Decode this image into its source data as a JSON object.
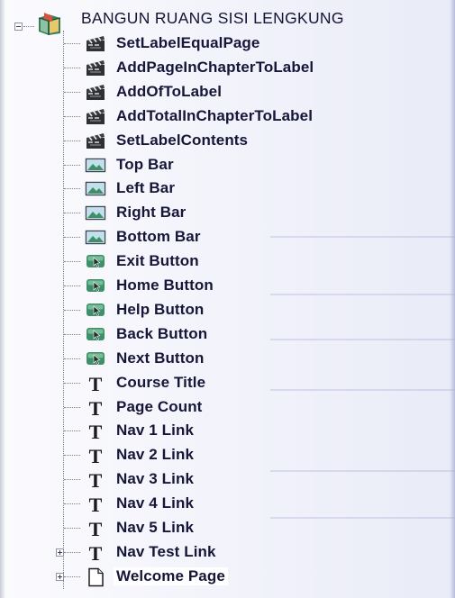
{
  "tree": {
    "root": {
      "label": "BANGUN RUANG SISI LENGKUNG",
      "icon": "book-icon",
      "expanded": true
    },
    "items": [
      {
        "label": "SetLabelEqualPage",
        "icon": "action-clapper-icon"
      },
      {
        "label": "AddPageInChapterToLabel",
        "icon": "action-clapper-icon"
      },
      {
        "label": "AddOfToLabel",
        "icon": "action-clapper-icon"
      },
      {
        "label": "AddTotalInChapterToLabel",
        "icon": "action-clapper-icon"
      },
      {
        "label": "SetLabelContents",
        "icon": "action-clapper-icon"
      },
      {
        "label": "Top Bar",
        "icon": "image-icon"
      },
      {
        "label": "Left Bar",
        "icon": "image-icon"
      },
      {
        "label": "Right Bar",
        "icon": "image-icon"
      },
      {
        "label": "Bottom Bar",
        "icon": "image-icon"
      },
      {
        "label": "Exit Button",
        "icon": "button-icon"
      },
      {
        "label": "Home Button",
        "icon": "button-icon"
      },
      {
        "label": "Help Button",
        "icon": "button-icon"
      },
      {
        "label": "Back Button",
        "icon": "button-icon"
      },
      {
        "label": "Next Button",
        "icon": "button-icon"
      },
      {
        "label": "Course Title",
        "icon": "text-icon"
      },
      {
        "label": "Page Count",
        "icon": "text-icon"
      },
      {
        "label": "Nav 1 Link",
        "icon": "text-icon"
      },
      {
        "label": "Nav 2 Link",
        "icon": "text-icon"
      },
      {
        "label": "Nav 3 Link",
        "icon": "text-icon"
      },
      {
        "label": "Nav 4 Link",
        "icon": "text-icon"
      },
      {
        "label": "Nav 5 Link",
        "icon": "text-icon"
      },
      {
        "label": "Nav Test Link",
        "icon": "text-icon",
        "expandable": true
      },
      {
        "label": "Welcome Page",
        "icon": "page-icon",
        "expandable": true,
        "selected": true
      }
    ]
  },
  "colors": {
    "text": "#151638",
    "selection": "#ffffff",
    "connector": "#7b7f90",
    "icon_green": "#3f8f6a",
    "icon_dark": "#2a2d33"
  }
}
